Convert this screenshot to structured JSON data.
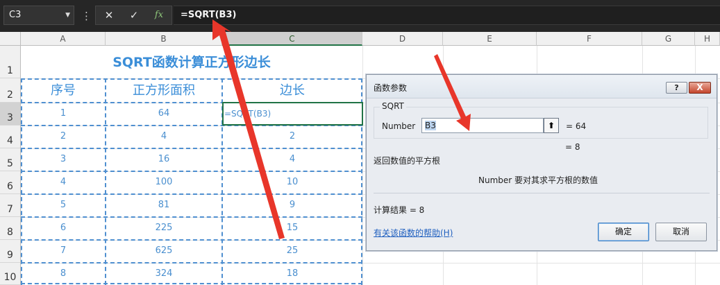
{
  "formula_bar": {
    "name_box": "C3",
    "formula": "=SQRT(B3)",
    "cancel_icon": "close-icon",
    "enter_icon": "check-icon",
    "fx_label": "fx"
  },
  "columns": [
    "A",
    "B",
    "C",
    "D",
    "E",
    "F",
    "G",
    "H"
  ],
  "rows": [
    "1",
    "2",
    "3",
    "4",
    "5",
    "6",
    "7",
    "8",
    "9",
    "10"
  ],
  "sheet": {
    "title": "SQRT函数计算正方形边长",
    "headers": [
      "序号",
      "正方形面积",
      "边长"
    ],
    "data": [
      {
        "no": "1",
        "area": "64",
        "side": "=SQRT(B3)"
      },
      {
        "no": "2",
        "area": "4",
        "side": "2"
      },
      {
        "no": "3",
        "area": "16",
        "side": "4"
      },
      {
        "no": "4",
        "area": "100",
        "side": "10"
      },
      {
        "no": "5",
        "area": "81",
        "side": "9"
      },
      {
        "no": "6",
        "area": "225",
        "side": "15"
      },
      {
        "no": "7",
        "area": "625",
        "side": "25"
      },
      {
        "no": "8",
        "area": "324",
        "side": "18"
      }
    ]
  },
  "dialog": {
    "title": "函数参数",
    "help_button": "?",
    "close_button": "X",
    "function_name": "SQRT",
    "arg_label": "Number",
    "arg_value": "B3",
    "arg_result": "=  64",
    "formula_result": "=  8",
    "description": "返回数值的平方根",
    "arg_description": "Number   要对其求平方根的数值",
    "calc_result": "计算结果 =   8",
    "help_link": "有关该函数的帮助(H)",
    "ok_label": "确定",
    "cancel_label": "取消"
  },
  "colors": {
    "accent_blue": "#3b8ed8",
    "selection_green": "#217346",
    "arrow_red": "#e8362a"
  }
}
